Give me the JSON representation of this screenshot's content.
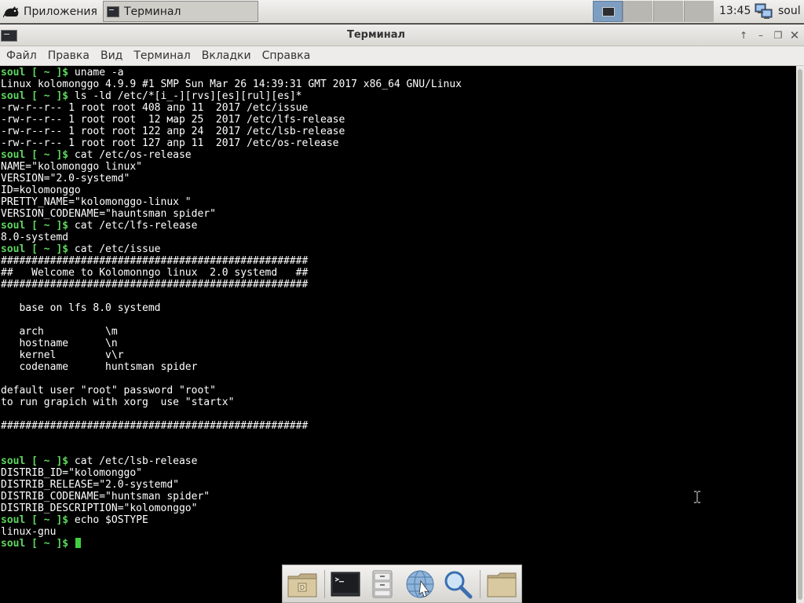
{
  "panel": {
    "apps_label": "Приложения",
    "task_label": "Терминал",
    "clock": "13:45",
    "user": "soul"
  },
  "window": {
    "title": "Терминал"
  },
  "menu": [
    "Файл",
    "Правка",
    "Вид",
    "Терминал",
    "Вкладки",
    "Справка"
  ],
  "terminal": {
    "lines": [
      {
        "p": "soul [ ~ ]$ ",
        "t": "uname -a"
      },
      {
        "t": "Linux kolomonggo 4.9.9 #1 SMP Sun Mar 26 14:39:31 GMT 2017 x86_64 GNU/Linux"
      },
      {
        "p": "soul [ ~ ]$ ",
        "t": "ls -ld /etc/*[i_-][rvs][es][rul][es]*"
      },
      {
        "t": "-rw-r--r-- 1 root root 408 апр 11  2017 /etc/issue"
      },
      {
        "t": "-rw-r--r-- 1 root root  12 мар 25  2017 /etc/lfs-release"
      },
      {
        "t": "-rw-r--r-- 1 root root 122 апр 24  2017 /etc/lsb-release"
      },
      {
        "t": "-rw-r--r-- 1 root root 127 апр 11  2017 /etc/os-release"
      },
      {
        "p": "soul [ ~ ]$ ",
        "t": "cat /etc/os-release"
      },
      {
        "t": "NAME=\"kolomonggo linux\""
      },
      {
        "t": "VERSION=\"2.0-systemd\""
      },
      {
        "t": "ID=kolomonggo"
      },
      {
        "t": "PRETTY_NAME=\"kolomonggo-linux \""
      },
      {
        "t": "VERSION_CODENAME=\"hauntsman spider\""
      },
      {
        "p": "soul [ ~ ]$ ",
        "t": "cat /etc/lfs-release"
      },
      {
        "t": "8.0-systemd"
      },
      {
        "p": "soul [ ~ ]$ ",
        "t": "cat /etc/issue"
      },
      {
        "t": "##################################################"
      },
      {
        "t": "##   Welcome to Kolomonngo linux  2.0 systemd   ##"
      },
      {
        "t": "##################################################"
      },
      {
        "t": ""
      },
      {
        "t": "   base on lfs 8.0 systemd"
      },
      {
        "t": ""
      },
      {
        "t": "   arch          \\m"
      },
      {
        "t": "   hostname      \\n"
      },
      {
        "t": "   kernel        v\\r"
      },
      {
        "t": "   codename      huntsman spider"
      },
      {
        "t": ""
      },
      {
        "t": "default user \"root\" password \"root\""
      },
      {
        "t": "to run grapich with xorg  use \"startx\""
      },
      {
        "t": ""
      },
      {
        "t": "##################################################"
      },
      {
        "t": ""
      },
      {
        "t": ""
      },
      {
        "p": "soul [ ~ ]$ ",
        "t": "cat /etc/lsb-release"
      },
      {
        "t": "DISTRIB_ID=\"kolomonggo\""
      },
      {
        "t": "DISTRIB_RELEASE=\"2.0-systemd\""
      },
      {
        "t": "DISTRIB_CODENAME=\"huntsman spider\""
      },
      {
        "t": "DISTRIB_DESCRIPTION=\"kolomonggo\""
      },
      {
        "p": "soul [ ~ ]$ ",
        "t": "echo $OSTYPE"
      },
      {
        "t": "linux-gnu"
      },
      {
        "p": "soul [ ~ ]$ ",
        "t": "",
        "cursor": true
      }
    ]
  },
  "colors": {
    "prompt": "#5fd75f",
    "terminal_bg": "#000000",
    "active_workspace": "#7d9ec0"
  }
}
